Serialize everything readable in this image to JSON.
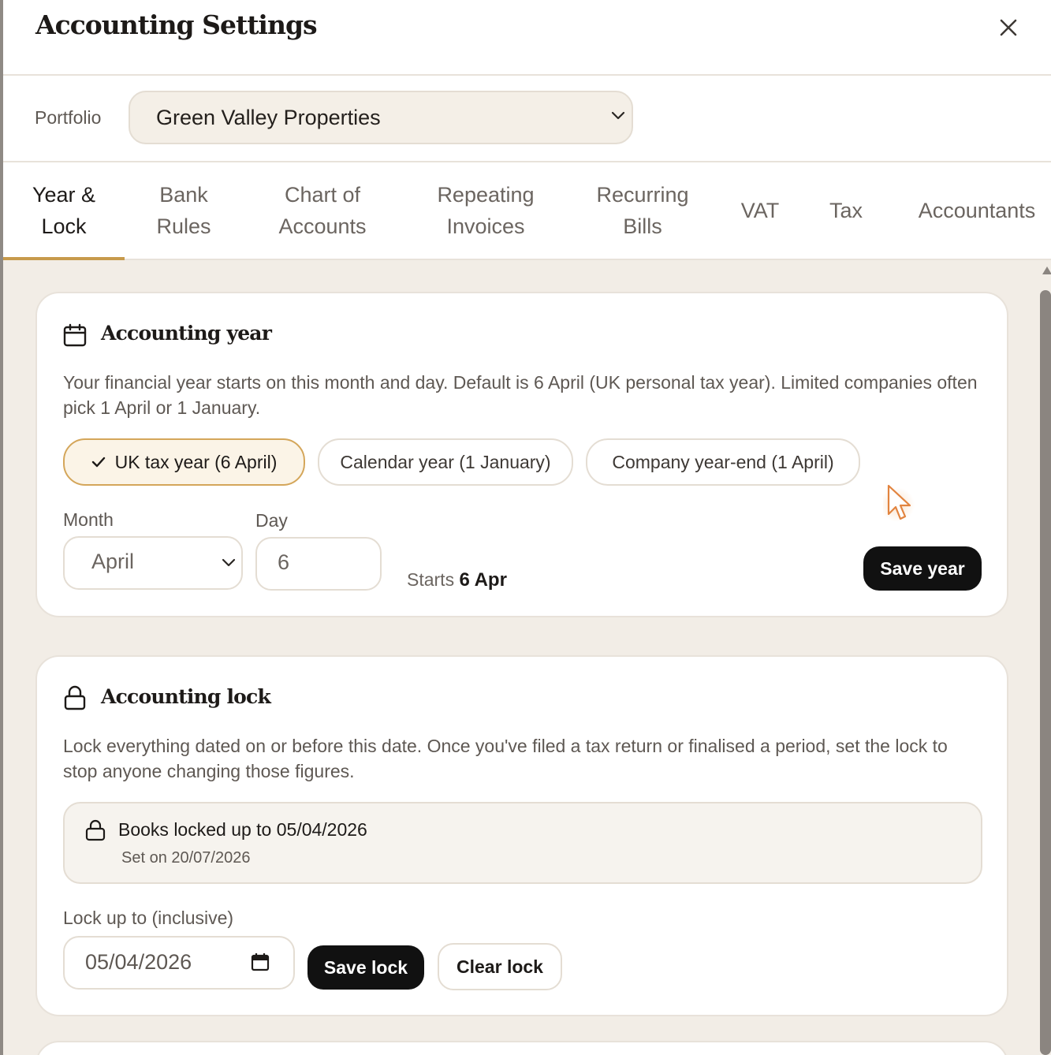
{
  "header": {
    "title": "Accounting Settings",
    "close_icon": "close-icon"
  },
  "portfolio": {
    "label": "Portfolio",
    "selected": "Green Valley Properties"
  },
  "tabs": [
    {
      "label": "Year &\nLock",
      "active": true
    },
    {
      "label": "Bank\nRules",
      "active": false
    },
    {
      "label": "Chart of\nAccounts",
      "active": false
    },
    {
      "label": "Repeating\nInvoices",
      "active": false
    },
    {
      "label": "Recurring\nBills",
      "active": false
    },
    {
      "label": "VAT",
      "active": false
    },
    {
      "label": "Tax",
      "active": false
    },
    {
      "label": "Accountants",
      "active": false
    }
  ],
  "accounting_year": {
    "title": "Accounting year",
    "icon": "calendar-icon",
    "description": "Your financial year starts on this month and day. Default is 6 April (UK personal tax year). Limited companies often pick 1 April or 1 January.",
    "presets": [
      {
        "label": "UK tax year (6 April)",
        "selected": true
      },
      {
        "label": "Calendar year (1 January)",
        "selected": false
      },
      {
        "label": "Company year-end (1 April)",
        "selected": false
      }
    ],
    "month_label": "Month",
    "month_value": "April",
    "day_label": "Day",
    "day_value": "6",
    "starts_prefix": "Starts",
    "starts_value": "6 Apr",
    "save_label": "Save year"
  },
  "accounting_lock": {
    "title": "Accounting lock",
    "icon": "lock-icon",
    "description": "Lock everything dated on or before this date. Once you've filed a tax return or finalised a period, set the lock to stop anyone changing those figures.",
    "status_main": "Books locked up to 05/04/2026",
    "status_sub": "Set on 20/07/2026",
    "input_label": "Lock up to (inclusive)",
    "input_value": "05/04/2026",
    "save_label": "Save lock",
    "clear_label": "Clear lock"
  },
  "colors": {
    "accent": "#c79a4b",
    "background": "#f2ede6",
    "primary_button": "#111111"
  }
}
